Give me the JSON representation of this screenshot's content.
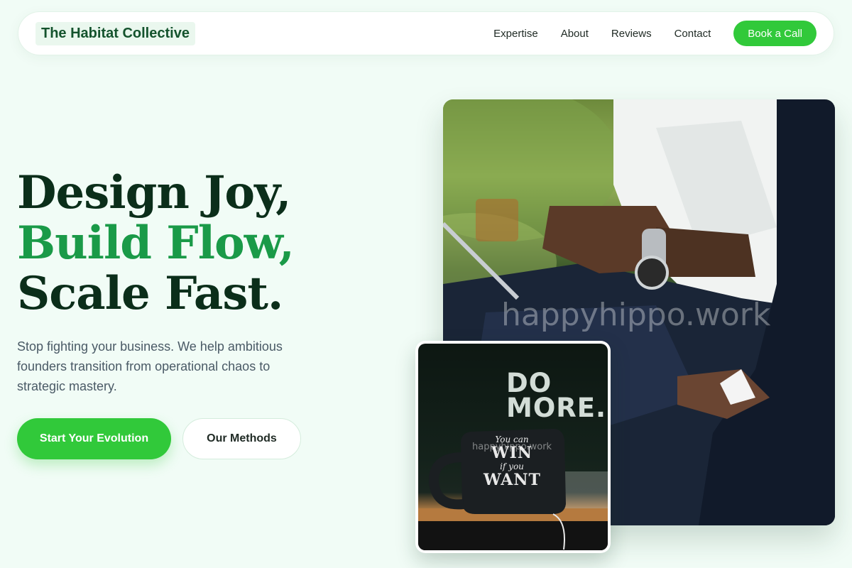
{
  "nav": {
    "brand": "The Habitat Collective",
    "links": [
      "Expertise",
      "About",
      "Reviews",
      "Contact"
    ],
    "cta": "Book a Call"
  },
  "hero": {
    "title_line1": "Design Joy,",
    "title_line2": "Build Flow,",
    "title_line3": "Scale Fast.",
    "subtitle": "Stop fighting your business. We help ambitious founders transition from operational chaos to strategic mastery.",
    "primary_button": "Start Your Evolution",
    "secondary_button": "Our Methods"
  },
  "images": {
    "main_watermark": "happyhippo.work",
    "inset_watermark": "happyhippo.work",
    "poster_line1": "DO",
    "poster_line2": "MORE.",
    "mug_line1": "You can",
    "mug_line2": "WIN",
    "mug_line3": "if you",
    "mug_line4": "WANT"
  },
  "colors": {
    "accent_green": "#31c93a",
    "title_dark": "#0b2e1a",
    "title_accent": "#1a9a48",
    "page_background": "#f1fcf6"
  }
}
